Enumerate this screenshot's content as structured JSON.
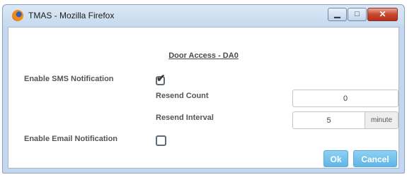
{
  "window": {
    "title": "TMAS - Mozilla Firefox",
    "controls": {
      "minimize_glyph": "▁",
      "maximize_glyph": "□",
      "close_glyph": "✕"
    }
  },
  "dialog": {
    "heading": "Door Access - DA0",
    "sms": {
      "label": "Enable SMS Notification",
      "checked": true,
      "resend_count_label": "Resend Count",
      "resend_count_value": "0",
      "resend_interval_label": "Resend Interval",
      "resend_interval_value": "5",
      "resend_interval_unit": "minute"
    },
    "email": {
      "label": "Enable Email Notification",
      "checked": false
    },
    "buttons": {
      "ok": "Ok",
      "cancel": "Cancel"
    }
  },
  "colors": {
    "button_blue": "#6cbfee",
    "title_bar": "#c7d9ee",
    "close_red": "#c9452f"
  },
  "icons": {
    "app": "firefox-icon",
    "checkmark": "✔"
  }
}
